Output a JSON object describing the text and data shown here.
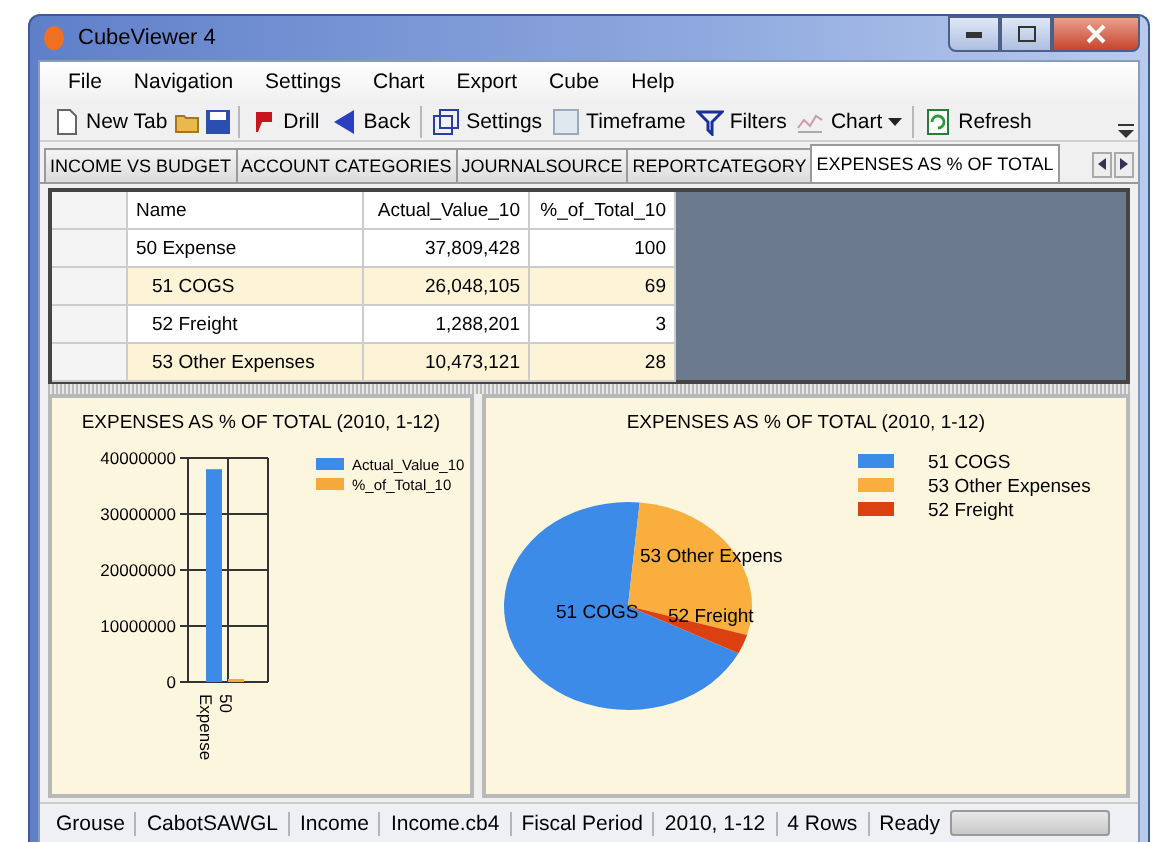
{
  "window": {
    "title": "CubeViewer 4"
  },
  "menu": [
    "File",
    "Navigation",
    "Settings",
    "Chart",
    "Export",
    "Cube",
    "Help"
  ],
  "toolbar": {
    "new_tab": "New Tab",
    "drill": "Drill",
    "back": "Back",
    "settings": "Settings",
    "timeframe": "Timeframe",
    "filters": "Filters",
    "chart": "Chart",
    "refresh": "Refresh"
  },
  "tabs": [
    {
      "label": "INCOME VS BUDGET",
      "selected": false
    },
    {
      "label": "ACCOUNT CATEGORIES",
      "selected": false
    },
    {
      "label": "JOURNALSOURCE",
      "selected": false
    },
    {
      "label": "REPORTCATEGORY",
      "selected": false
    },
    {
      "label": "EXPENSES AS % OF TOTAL",
      "selected": true
    }
  ],
  "table": {
    "columns": [
      "Name",
      "Actual_Value_10",
      "%_of_Total_10"
    ],
    "rows": [
      {
        "cells": [
          "50 Expense",
          "37,809,428",
          "100"
        ],
        "children": [
          {
            "cells": [
              "51 COGS",
              "26,048,105",
              "69"
            ]
          },
          {
            "cells": [
              "52 Freight",
              "1,288,201",
              "3"
            ]
          },
          {
            "cells": [
              "53 Other Expenses",
              "10,473,121",
              "28"
            ]
          }
        ]
      }
    ]
  },
  "bar_chart": {
    "chart_data": {
      "type": "bar",
      "title": "EXPENSES AS % OF TOTAL (2010, 1-12)",
      "categories": [
        "50 Expense"
      ],
      "series": [
        {
          "name": "Actual_Value_10",
          "color": "#3d8be8",
          "values": [
            38000000
          ]
        },
        {
          "name": "%_of_Total_10",
          "color": "#f6a93a",
          "values": [
            0
          ]
        }
      ],
      "ylim": [
        0,
        40000000
      ],
      "yticks": [
        0,
        10000000,
        20000000,
        30000000,
        40000000
      ],
      "grid": true,
      "legend": true
    }
  },
  "pie_chart": {
    "chart_data": {
      "type": "pie",
      "title": "EXPENSES AS % OF TOTAL (2010, 1-12)",
      "categories": [
        "51 COGS",
        "53 Other Expenses",
        "52 Freight"
      ],
      "series": [
        {
          "values": [
            69,
            28,
            3
          ]
        }
      ],
      "colors": [
        "#3d8be8",
        "#f9ae3e",
        "#dd4010"
      ],
      "annotations": [
        {
          "text": "51 COGS"
        },
        {
          "text": "53 Other Expens"
        },
        {
          "text": "52 Freight"
        }
      ],
      "legend": true
    }
  },
  "status_bar": {
    "items": [
      "Grouse",
      "CabotSAWGL",
      "Income",
      "Income.cb4",
      "Fiscal Period",
      "2010, 1-12",
      "4 Rows",
      "Ready"
    ],
    "progress": {
      "level": 0
    }
  }
}
